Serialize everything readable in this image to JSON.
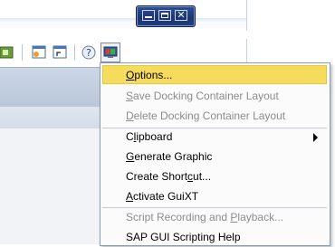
{
  "window": {
    "controls": {
      "close_glyph": "✕"
    }
  },
  "toolbar": {
    "icons": [
      "layout-icon",
      "new-session-icon",
      "create-shortcut-icon",
      "help-icon",
      "customize-layout-icon"
    ],
    "help_glyph": "?"
  },
  "menu": {
    "items": [
      {
        "pre": "",
        "key": "O",
        "post": "ptions...",
        "state": "highlighted"
      },
      {
        "pre": "",
        "key": "S",
        "post": "ave Docking Container Layout",
        "state": "disabled"
      },
      {
        "pre": "",
        "key": "D",
        "post": "elete Docking Container Layout",
        "state": "disabled"
      },
      {
        "pre": "C",
        "key": "l",
        "post": "ipboard",
        "state": "submenu"
      },
      {
        "pre": "",
        "key": "G",
        "post": "enerate Graphic",
        "state": "enabled"
      },
      {
        "pre": "Create Short",
        "key": "c",
        "post": "ut...",
        "state": "enabled"
      },
      {
        "pre": "",
        "key": "A",
        "post": "ctivate GuiXT",
        "state": "enabled"
      },
      {
        "pre": "Script Recording and ",
        "key": "P",
        "post": "layback...",
        "state": "disabled"
      },
      {
        "pre": "SAP GUI Scripting Help",
        "key": "",
        "post": "",
        "state": "enabled"
      }
    ]
  },
  "colors": {
    "highlight": "#f6dc5c",
    "disabled_text": "#8c8c8c",
    "title_controls": "#1a3570"
  }
}
